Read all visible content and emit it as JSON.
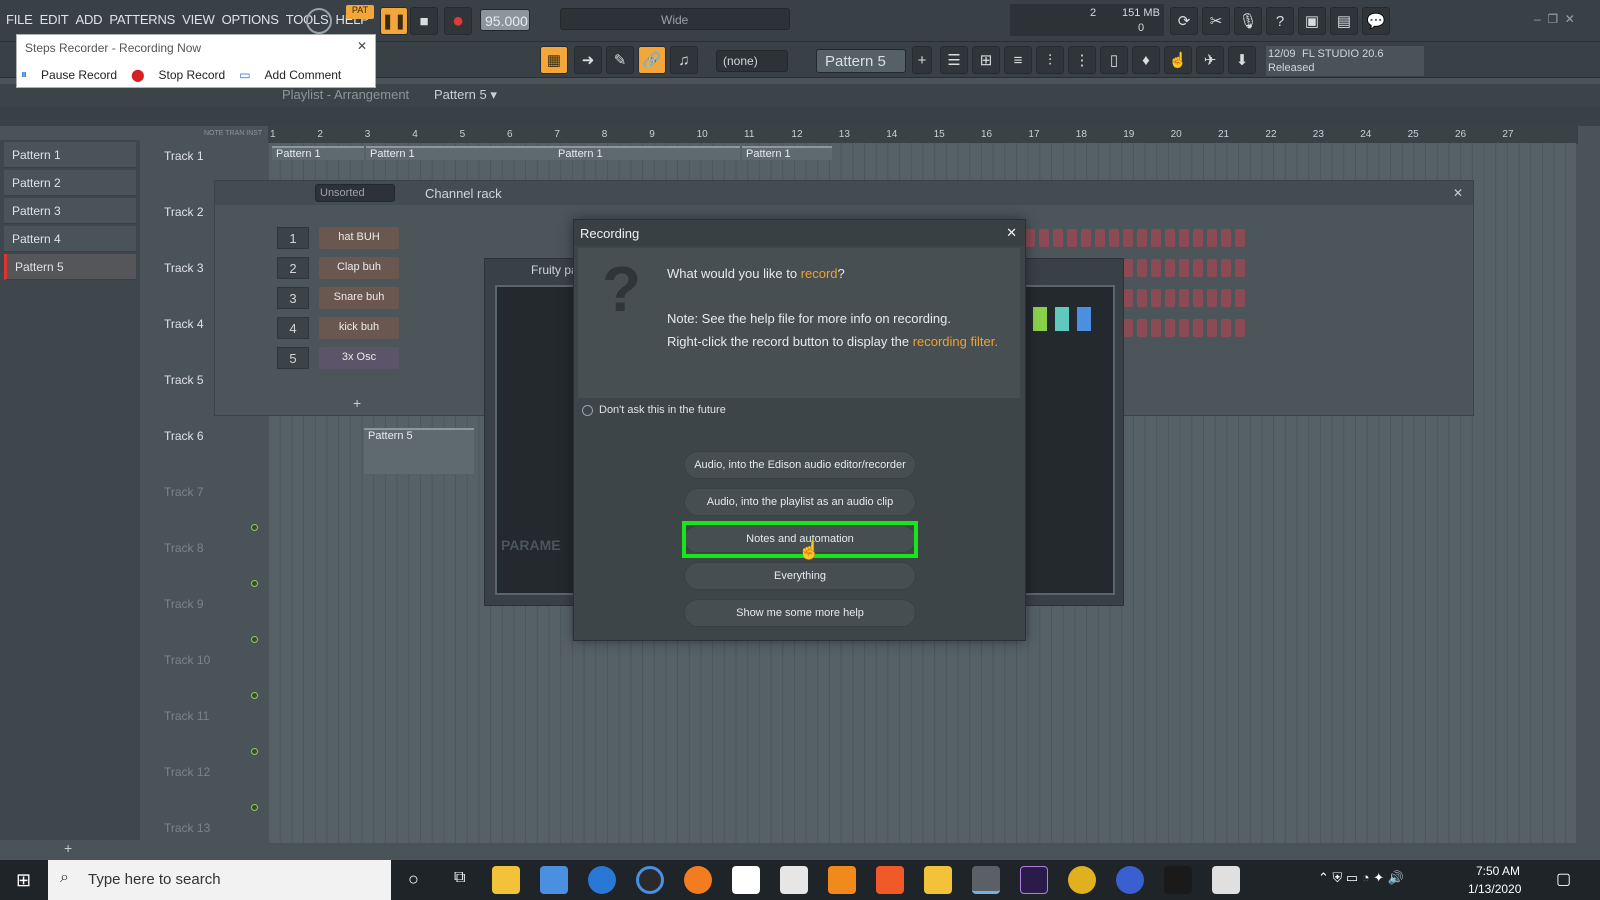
{
  "menu": [
    "FILE",
    "EDIT",
    "ADD",
    "PATTERNS",
    "VIEW",
    "OPTIONS",
    "TOOLS",
    "HELP"
  ],
  "transport": {
    "pat_label": "PAT",
    "tempo": "95.000",
    "snap": "Wide",
    "memory": "151 MB",
    "counter_top": "2",
    "counter_bottom": "0"
  },
  "toolbar2": {
    "preset": "(none)",
    "pattern": "Pattern 5",
    "news_date": "12/09",
    "news_title": "FL STUDIO 20.6",
    "news_status": "Released"
  },
  "steps_recorder": {
    "title": "Steps Recorder - Recording Now",
    "pause": "Pause Record",
    "stop": "Stop Record",
    "comment": "Add Comment"
  },
  "playlist": {
    "title": "Playlist - Arrangement",
    "pattern": "Pattern 5 ▾",
    "ruler": [
      "1",
      "2",
      "3",
      "4",
      "5",
      "6",
      "7",
      "8",
      "9",
      "10",
      "11",
      "12",
      "13",
      "14",
      "15",
      "16",
      "17",
      "18",
      "19",
      "20",
      "21",
      "22",
      "23",
      "24",
      "25",
      "26",
      "27"
    ],
    "ruler_note": "NOTE TRAN INST"
  },
  "patterns": [
    "Pattern 1",
    "Pattern 2",
    "Pattern 3",
    "Pattern 4",
    "Pattern 5"
  ],
  "tracks": [
    "Track 1",
    "Track 2",
    "Track 3",
    "Track 4",
    "Track 5",
    "Track 6",
    "Track 7",
    "Track 8",
    "Track 9",
    "Track 10",
    "Track 11",
    "Track 12",
    "Track 13"
  ],
  "clips": {
    "c1": "Pattern 1",
    "c2": "Pattern 1",
    "c3": "Pattern 1",
    "c4": "Pattern 1",
    "c5": "Pattern 5"
  },
  "channel_rack": {
    "title": "Channel rack",
    "filter": "Unsorted",
    "channels": [
      {
        "n": "1",
        "name": "hat BUH"
      },
      {
        "n": "2",
        "name": "Clap buh"
      },
      {
        "n": "3",
        "name": "Snare buh"
      },
      {
        "n": "4",
        "name": "kick buh"
      },
      {
        "n": "5",
        "name": "3x Osc"
      }
    ],
    "add": "+"
  },
  "plugin": {
    "title": "Fruity pa",
    "param_label": "PARAME"
  },
  "dialog": {
    "title": "Recording",
    "question": "What would you like to ",
    "question_link": "record",
    "question_end": "?",
    "note1": "Note: See the help file for more info on recording.",
    "note2": "Right-click the record button to display the ",
    "note2_link": "recording filter.",
    "dont_ask": "Don't ask this in the future",
    "buttons": [
      "Audio, into the Edison audio editor/recorder",
      "Audio, into the playlist as an audio clip",
      "Notes and automation",
      "Everything",
      "Show me some more help"
    ]
  },
  "taskbar": {
    "search": "Type here to search",
    "time": "7:50 AM",
    "date": "1/13/2020"
  },
  "colors": {
    "accent": "#f3a73b",
    "highlight": "#1ae51a",
    "link": "#f0a030"
  }
}
